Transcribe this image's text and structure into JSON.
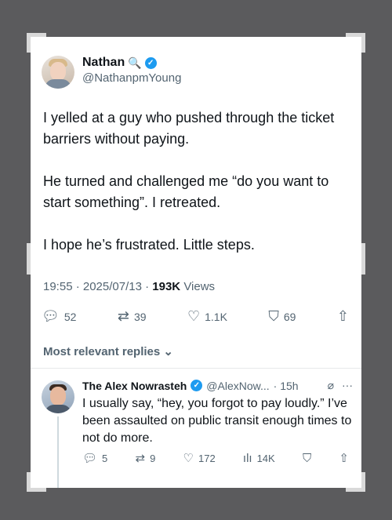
{
  "tweet": {
    "author_name": "Nathan",
    "author_handle": "@NathanpmYoung",
    "paragraphs": [
      "I yelled at a guy who pushed through the ticket barriers without paying.",
      "He turned and challenged me “do you want to start something”. I retreated.",
      "I hope he’s frustrated. Little steps."
    ],
    "timestamp": "19:55 · 2025/07/13 ·",
    "views_count": "193K",
    "views_label": "Views",
    "actions": {
      "replies": "52",
      "reposts": "39",
      "likes": "1.1K",
      "bookmarks": "69"
    }
  },
  "replies_filter": "Most relevant replies",
  "reply": {
    "author_name": "The Alex Nowrasteh",
    "author_handle": "@AlexNow...",
    "time": "· 15h",
    "text": "I usually say, “hey, you forgot to pay loudly.” I’ve been assaulted on public transit enough times to not do more.",
    "actions": {
      "replies": "5",
      "reposts": "9",
      "likes": "172",
      "views": "14K"
    }
  },
  "colors": {
    "accent": "#1d9bf0",
    "text": "#0f1419",
    "muted": "#536471",
    "background": "#5b5b5d"
  },
  "icons": [
    "magnifier-icon",
    "verified-icon",
    "reply-icon",
    "repost-icon",
    "like-icon",
    "bookmark-icon",
    "share-icon",
    "views-icon",
    "grok-icon",
    "more-icon",
    "chevron-down-icon"
  ]
}
